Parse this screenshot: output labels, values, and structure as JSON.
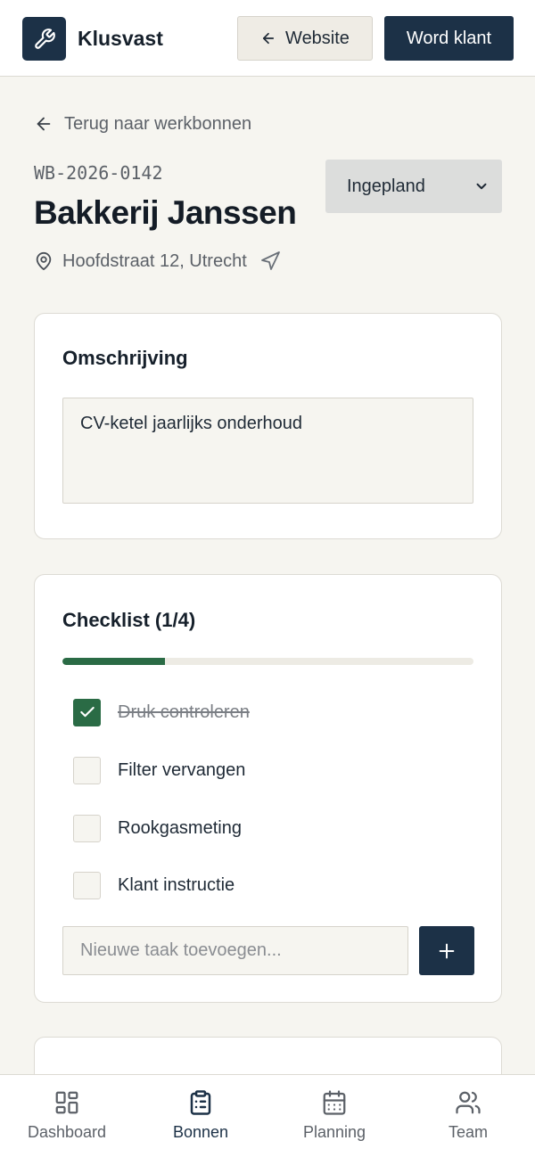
{
  "header": {
    "brand": "Klusvast",
    "website_label": "Website",
    "cta_label": "Word klant"
  },
  "job": {
    "back_label": "Terug naar werkbonnen",
    "number": "WB-2026-0142",
    "title": "Bakkerij Janssen",
    "address": "Hoofdstraat 12, Utrecht",
    "status": "Ingepland"
  },
  "description_card": {
    "title": "Omschrijving",
    "text": "CV-ketel jaarlijks onderhoud"
  },
  "checklist": {
    "title": "Checklist (1/4)",
    "progress": 0.25,
    "items": [
      {
        "label": "Druk controleren",
        "done": true
      },
      {
        "label": "Filter vervangen",
        "done": false
      },
      {
        "label": "Rookgasmeting",
        "done": false
      },
      {
        "label": "Klant instructie",
        "done": false
      }
    ],
    "new_task_placeholder": "Nieuwe taak toevoegen..."
  },
  "nav": {
    "items": [
      {
        "label": "Dashboard",
        "icon": "dashboard-icon"
      },
      {
        "label": "Bonnen",
        "icon": "clipboard-icon",
        "active": true
      },
      {
        "label": "Planning",
        "icon": "calendar-icon"
      },
      {
        "label": "Team",
        "icon": "team-icon"
      }
    ]
  },
  "colors": {
    "primary": "#1c3147",
    "success": "#2a6b45",
    "background": "#f6f5f0"
  }
}
